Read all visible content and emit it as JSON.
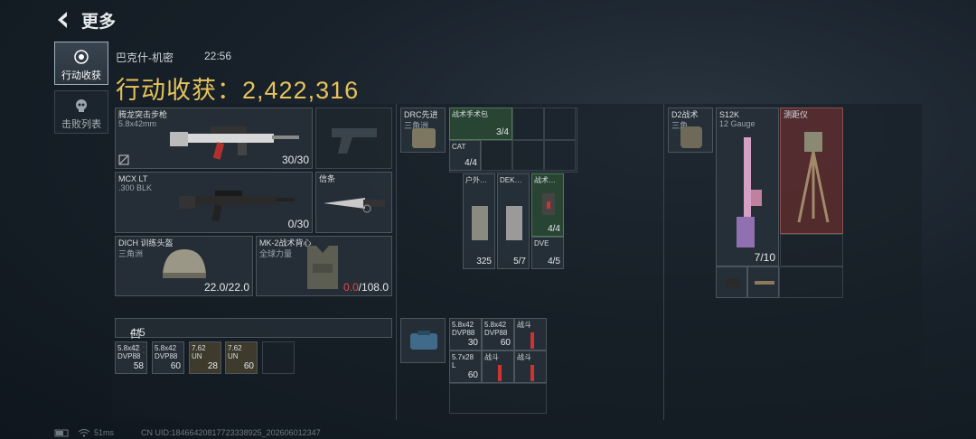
{
  "header": {
    "title": "更多"
  },
  "tabs": [
    {
      "label": "行动收获",
      "active": true
    },
    {
      "label": "击败列表",
      "active": false
    }
  ],
  "match": {
    "map": "巴克什-机密",
    "time": "22:56"
  },
  "harvest": {
    "label": "行动收获：",
    "value": "2,422,316"
  },
  "equipment": {
    "primary": {
      "name": "腾龙突击步枪",
      "caliber": "5.8x42mm",
      "ammo": "30/30"
    },
    "secondary": {
      "name": "MCX LT",
      "caliber": ".300 BLK",
      "ammo": "0/30"
    },
    "melee": {
      "name": "信条"
    },
    "helmet": {
      "name": "DICH 训练头盔",
      "faction": "三角洲",
      "durability": "22.0/22.0"
    },
    "armor": {
      "name": "MK-2战术背心",
      "faction": "全球力量",
      "durability_current": "0.0",
      "durability_max": "/108.0"
    }
  },
  "pockets": {
    "label": "口袋：",
    "count": "4/5",
    "items": [
      {
        "line1": "5.8x42",
        "line2": "DVP88",
        "count": "58"
      },
      {
        "line1": "5.8x42",
        "line2": "DVP88",
        "count": "60"
      },
      {
        "line1": "7.62",
        "line2": "UN",
        "count": "28"
      },
      {
        "line1": "7.62",
        "line2": "UN",
        "count": "60"
      }
    ]
  },
  "chest_rig": {
    "name": "DRC先进",
    "faction": "三角洲",
    "items": [
      {
        "name": "战术手术包",
        "count": "3/4"
      },
      {
        "name": "CAT",
        "count": "4/4"
      }
    ]
  },
  "backpack_sub": [
    {
      "name": "户外…",
      "count": "325"
    },
    {
      "name": "DEK…",
      "count": "5/7"
    },
    {
      "name": "战术…",
      "count": "4/4"
    },
    {
      "name": "DVE",
      "count": "4/5"
    }
  ],
  "case_items": [
    {
      "line1": "5.8x42",
      "line2": "DVP88",
      "count": "30"
    },
    {
      "line1": "5.8x42",
      "line2": "DVP88",
      "count": "60"
    },
    {
      "line1": "战斗",
      "line2": "",
      "count": ""
    },
    {
      "line1": "5.7x28",
      "line2": "L",
      "count": "60"
    },
    {
      "line1": "战斗",
      "line2": "",
      "count": ""
    },
    {
      "line1": "战斗",
      "line2": "",
      "count": ""
    }
  ],
  "backpack": {
    "name": "D2战术",
    "faction": "三角",
    "weapon": {
      "name": "S12K",
      "caliber": "12 Gauge",
      "ammo": "7/10"
    },
    "extra": {
      "name": "测距仪"
    }
  },
  "footer": {
    "ms": "51ms",
    "uid": "CN UID:18466420817723338925_202606012347"
  },
  "colors": {
    "accent": "#e6c35b",
    "danger": "#e04848",
    "green": "#4f7a58"
  }
}
